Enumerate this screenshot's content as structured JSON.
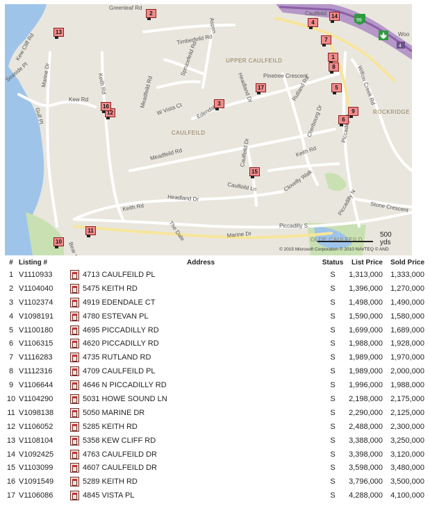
{
  "map": {
    "copyright": "© 2015 Microsoft Corporation   © 2010 NAVTEQ   © AND",
    "scale_label": "500 yds",
    "highway_number": "99",
    "road_shield": "4",
    "labels": {
      "greenleaf": "Greenleaf Rd",
      "aspen": "Aspen",
      "caulfeild_top": "Caulfeild",
      "wood": "Woo",
      "timberfeild": "Timberfeild Rd",
      "upper_caulfeild": "UPPER CAULFEILD",
      "kew_cliff": "Kew Cliff Rd",
      "marine": "Marine Dr",
      "keith": "Keith Rd",
      "sprucefeild": "Sprucefeild Rd",
      "pinetree": "Pinetree Crescent",
      "headland": "Headland Dr",
      "rutland": "Rutland Rd",
      "willow": "Willow Creek Rd",
      "kew": "Kew Rd",
      "meadfeild": "Meadfeild Rd",
      "vista": "W Vista Ct",
      "edendale": "Edendale Ct",
      "caulfeild_area": "CAULFEILD",
      "rockridge": "ROCKRIDGE",
      "cherbourg": "Cherbourg Dr",
      "piccadilly_n": "Piccadilly N",
      "gulf": "Gulf Pl",
      "seaside": "Seaside Pl",
      "meadfeild2": "Meadfeild Rd",
      "caulfeild_dr": "Caulfeild Dr",
      "keith2": "Keith Rd",
      "caulfeild_ln": "Caulfeild Ln",
      "clovelly": "Clovelly Walk",
      "headland2": "Headland Dr",
      "keith3": "Keith Rd",
      "stone": "Stone Crescent",
      "piccadilly_n2": "Piccadilly N",
      "the_dale": "The Dale",
      "marine2": "Marine Dr",
      "piccadilly_s": "Piccadilly S",
      "bear": "Bear Ln",
      "olde_caulfeild": "OLDE CAULFEILD"
    },
    "markers": [
      "1",
      "2",
      "3",
      "4",
      "5",
      "6",
      "7",
      "8",
      "9",
      "10",
      "11",
      "12",
      "13",
      "14",
      "15",
      "16",
      "17"
    ]
  },
  "table": {
    "headers": {
      "num": "#",
      "listing": "Listing #",
      "address": "Address",
      "status": "Status",
      "list_price": "List Price",
      "sold_price": "Sold Price"
    },
    "rows": [
      {
        "num": "1",
        "listing": "V1110933",
        "address": "4713 CAULFEILD PL",
        "status": "S",
        "list_price": "1,313,000",
        "sold_price": "1,333,000"
      },
      {
        "num": "2",
        "listing": "V1104040",
        "address": "5475 KEITH RD",
        "status": "S",
        "list_price": "1,396,000",
        "sold_price": "1,270,000"
      },
      {
        "num": "3",
        "listing": "V1102374",
        "address": "4919 EDENDALE CT",
        "status": "S",
        "list_price": "1,498,000",
        "sold_price": "1,490,000"
      },
      {
        "num": "4",
        "listing": "V1098191",
        "address": "4780 ESTEVAN PL",
        "status": "S",
        "list_price": "1,590,000",
        "sold_price": "1,580,000"
      },
      {
        "num": "5",
        "listing": "V1100180",
        "address": "4695 PICCADILLY RD",
        "status": "S",
        "list_price": "1,699,000",
        "sold_price": "1,689,000"
      },
      {
        "num": "6",
        "listing": "V1106315",
        "address": "4620 PICCADILLY RD",
        "status": "S",
        "list_price": "1,988,000",
        "sold_price": "1,928,000"
      },
      {
        "num": "7",
        "listing": "V1116283",
        "address": "4735 RUTLAND RD",
        "status": "S",
        "list_price": "1,989,000",
        "sold_price": "1,970,000"
      },
      {
        "num": "8",
        "listing": "V1112316",
        "address": "4709 CAULFEILD PL",
        "status": "S",
        "list_price": "1,989,000",
        "sold_price": "2,000,000"
      },
      {
        "num": "9",
        "listing": "V1106644",
        "address": "4646 N PICCADILLY RD",
        "status": "S",
        "list_price": "1,996,000",
        "sold_price": "1,988,000"
      },
      {
        "num": "10",
        "listing": "V1104290",
        "address": "5031 HOWE SOUND LN",
        "status": "S",
        "list_price": "2,198,000",
        "sold_price": "2,175,000"
      },
      {
        "num": "11",
        "listing": "V1098138",
        "address": "5050 MARINE DR",
        "status": "S",
        "list_price": "2,290,000",
        "sold_price": "2,125,000"
      },
      {
        "num": "12",
        "listing": "V1106052",
        "address": "5285 KEITH RD",
        "status": "S",
        "list_price": "2,488,000",
        "sold_price": "2,300,000"
      },
      {
        "num": "13",
        "listing": "V1108104",
        "address": "5358 KEW CLIFF RD",
        "status": "S",
        "list_price": "3,388,000",
        "sold_price": "3,250,000"
      },
      {
        "num": "14",
        "listing": "V1092425",
        "address": "4763 CAULFEILD DR",
        "status": "S",
        "list_price": "3,398,000",
        "sold_price": "3,120,000"
      },
      {
        "num": "15",
        "listing": "V1103099",
        "address": "4607 CAULFEILD DR",
        "status": "S",
        "list_price": "3,598,000",
        "sold_price": "3,480,000"
      },
      {
        "num": "16",
        "listing": "V1091549",
        "address": "5289 KEITH RD",
        "status": "S",
        "list_price": "3,796,000",
        "sold_price": "3,500,000"
      },
      {
        "num": "17",
        "listing": "V1106086",
        "address": "4845 VISTA PL",
        "status": "S",
        "list_price": "4,288,000",
        "sold_price": "4,100,000"
      }
    ]
  }
}
